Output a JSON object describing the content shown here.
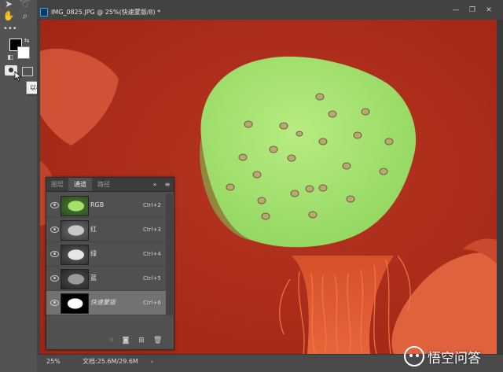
{
  "tooltip": {
    "text": "以标准模式编辑 (Q)"
  },
  "tools": {
    "move_icon": "move-tool-icon",
    "lasso_icon": "lasso-tool-icon",
    "hand_icon": "hand-tool-icon",
    "zoom_icon": "zoom-tool-icon",
    "more_icon": "more-tools-icon"
  },
  "document": {
    "tab_title": "IMG_0825.JPG @ 25%(快速蒙版/8) *",
    "status_zoom": "25%",
    "status_doc": "文档:25.6M/29.6M"
  },
  "panel": {
    "tabs": [
      "图层",
      "通道",
      "路径"
    ],
    "active_tab": 1,
    "channels": [
      {
        "name": "RGB",
        "shortcut": "Ctrl+2"
      },
      {
        "name": "红",
        "shortcut": "Ctrl+3"
      },
      {
        "name": "绿",
        "shortcut": "Ctrl+4"
      },
      {
        "name": "蓝",
        "shortcut": "Ctrl+5"
      },
      {
        "name": "快速蒙版",
        "shortcut": "Ctrl+6",
        "selected": true
      }
    ]
  },
  "watermark": {
    "text": "悟空问答"
  },
  "colors": {
    "mask_overlay": "#b52a18",
    "pod": "#a9e676",
    "ui_dark": "#535353",
    "selected_row": "#727272"
  }
}
